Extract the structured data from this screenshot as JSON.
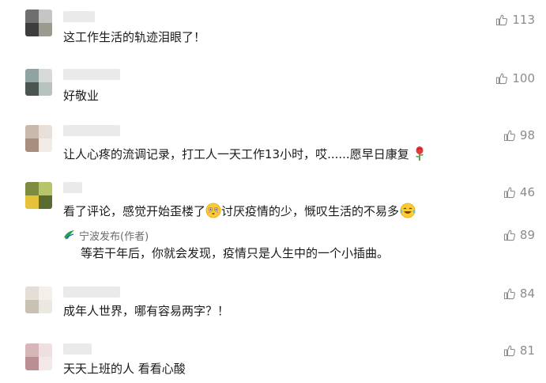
{
  "comments": [
    {
      "text": "这工作生活的轨迹泪眼了！",
      "likes": "113",
      "avatar": [
        "#6f6f6f",
        "#c5c5c5",
        "#3d3d3d",
        "#9a9a8e"
      ]
    },
    {
      "text": "好敬业",
      "likes": "100",
      "avatar": [
        "#8fa3a0",
        "#d9d9d9",
        "#4a5552",
        "#b8c3bd"
      ]
    },
    {
      "text": "让人心疼的流调记录，打工人一天工作13小时，哎......愿早日康复",
      "likes": "98",
      "avatar": [
        "#c9b9ad",
        "#e8e0d8",
        "#a88e7e",
        "#f1ece6"
      ]
    },
    {
      "text_before": "看了评论，感觉开始歪楼了",
      "text_mid": "讨厌疫情的少，慨叹生活的不易多",
      "likes": "46",
      "avatar": [
        "#7e8c3f",
        "#b6c46a",
        "#e6c23b",
        "#5a6b2f"
      ]
    },
    {
      "text": "成年人世界，哪有容易两字？！",
      "likes": "84",
      "avatar": [
        "#e3ded6",
        "#f3efe9",
        "#c9c1b4",
        "#ebe7e1"
      ]
    },
    {
      "text": "天天上班的人 看看心酸",
      "likes": "81",
      "avatar": [
        "#d7b6b8",
        "#eedfe0",
        "#b98f93",
        "#f3e8e8"
      ]
    }
  ],
  "reply": {
    "author": "宁波发布(作者)",
    "text": "等若干年后，你就会发现，疫情只是人生中的一个小插曲。",
    "likes": "89"
  },
  "icons": {
    "like": "thumbs-up-icon",
    "rose": "rose-emoji-icon",
    "flushed": "flushed-face-emoji-icon",
    "laughing": "tears-of-joy-emoji-icon"
  },
  "colors": {
    "like_gray": "#8c8c8c",
    "reply_name": "#6b6b6b",
    "logo_green": "#2aa04a"
  }
}
